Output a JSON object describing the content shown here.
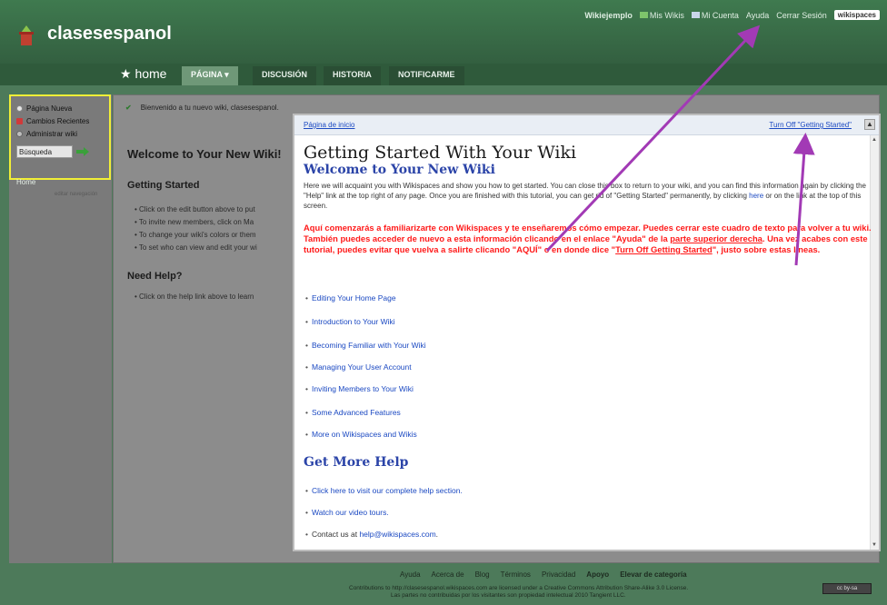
{
  "header": {
    "site_title": "clasesespanol",
    "userbar": [
      "Wikiejemplo",
      "Mis Wikis",
      "Mi Cuenta",
      "Ayuda",
      "Cerrar Sesión"
    ],
    "badge": "wikispaces"
  },
  "tabs": {
    "home": "★ home",
    "items": [
      "PÁGINA ▾",
      "DISCUSIÓN",
      "HISTORIA",
      "NOTIFICARME"
    ]
  },
  "sidebar": {
    "items": [
      "Página Nueva",
      "Cambios Recientes",
      "Administrar wiki"
    ],
    "search_value": "Búsqueda",
    "home": "Home",
    "edit_nav": "editar navegación"
  },
  "notice": {
    "text": "Bienvenido a tu nuevo wiki, clasesespanol."
  },
  "background": {
    "title": "Welcome to Your New Wiki!",
    "getting_started": "Getting Started",
    "items": [
      "Click on the edit button above to put",
      "To invite new members, click on Ma",
      "To change your wiki's colors or them",
      "To set who can view and edit your wi"
    ],
    "need_help": "Need Help?",
    "help_item": "Click on the help link above to learn"
  },
  "modal": {
    "header_left": "Página de inicio",
    "header_right": "Turn Off \"Getting Started\"",
    "close": "▲",
    "h1": "Getting Started With Your Wiki",
    "h2": "Welcome to Your New Wiki",
    "intro_1": "Here we will acquaint you with Wikispaces and show you how to get started. You can close this box to return to your wiki, and you can find this information again by clicking the \"Help\" link at the top right of any page. Once you are finished with this tutorial, you can get rid of \"Getting Started\" permanently, by clicking ",
    "intro_link": "here",
    "intro_2": " or on the link at the top of this screen.",
    "red_1": "Aquí comenzarás a familiarizarte con Wikispaces y te enseñaremos cómo empezar. Puedes cerrar este cuadro de texto para volver a tu wiki. También puedes acceder de nuevo a esta información clicando en el enlace \"Ayuda\" de la ",
    "red_u1": "parte superior derecha",
    "red_2": ". Una vez acabes con este tutorial, puedes evitar que vuelva a salirte clicando \"AQUÍ\" o en donde dice \"",
    "red_u2": "Turn Off Getting Started",
    "red_3": "\", justo sobre estas líneas.",
    "links": [
      "Editing Your Home Page",
      "Introduction to Your Wiki",
      "Becoming Familiar with Your Wiki",
      "Managing Your User Account",
      "Inviting Members to Your Wiki",
      "Some Advanced Features",
      "More on Wikispaces and Wikis"
    ],
    "h3": "Get More Help",
    "help_links": [
      "Click here to visit our complete help section.",
      "Watch our video tours."
    ],
    "contact_prefix": "Contact us at ",
    "contact_email": "help@wikispaces.com",
    "contact_suffix": "."
  },
  "footer": {
    "links": [
      "Ayuda",
      "Acerca de",
      "Blog",
      "Términos",
      "Privacidad",
      "Apoyo",
      "Elevar de categoría"
    ],
    "legal_1": "Contributions to http://clasesespanol.wikispaces.com are licensed under a Creative Commons Attribution Share-Alike 3.0 License.",
    "legal_2": "Las partes no contribuidas por los visitantes son propiedad intelectual 2010 Tangient LLC.",
    "cc": "cc by-sa"
  },
  "colors": {
    "accent": "#3f7a4f",
    "highlight_box": "#f1ef36",
    "annotation": "#a23ab5",
    "warning_text": "#ff1a1a",
    "link": "#1b49c2"
  }
}
